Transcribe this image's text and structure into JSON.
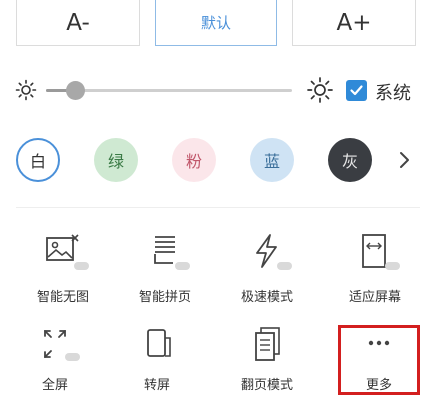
{
  "font_size": {
    "decrease_label": "A-",
    "default_label": "默认",
    "increase_label": "A+"
  },
  "brightness": {
    "level_fraction": 0.12,
    "system_label": "系统",
    "system_checked": true
  },
  "themes": [
    {
      "label": "白",
      "bg": "#ffffff",
      "fg": "#333333",
      "selected": true
    },
    {
      "label": "绿",
      "bg": "#cfe9d2",
      "fg": "#3a7a45",
      "selected": false
    },
    {
      "label": "粉",
      "bg": "#fbe6ea",
      "fg": "#c0566a",
      "selected": false
    },
    {
      "label": "蓝",
      "bg": "#cfe3f4",
      "fg": "#3b6f9a",
      "selected": false
    },
    {
      "label": "灰",
      "bg": "#3a3d42",
      "fg": "#e8e8e8",
      "selected": false
    }
  ],
  "tools_row1": [
    {
      "label": "智能无图",
      "icon": "image-off-icon"
    },
    {
      "label": "智能拼页",
      "icon": "page-join-icon"
    },
    {
      "label": "极速模式",
      "icon": "lightning-icon"
    },
    {
      "label": "适应屏幕",
      "icon": "fit-screen-icon"
    }
  ],
  "tools_row2": [
    {
      "label": "全屏",
      "icon": "fullscreen-icon"
    },
    {
      "label": "转屏",
      "icon": "rotate-screen-icon"
    },
    {
      "label": "翻页模式",
      "icon": "page-turn-icon"
    },
    {
      "label": "更多",
      "icon": "more-icon"
    }
  ],
  "colors": {
    "accent": "#4a90d9",
    "checkbox": "#2f8ad8",
    "highlight": "#d31f1f"
  }
}
